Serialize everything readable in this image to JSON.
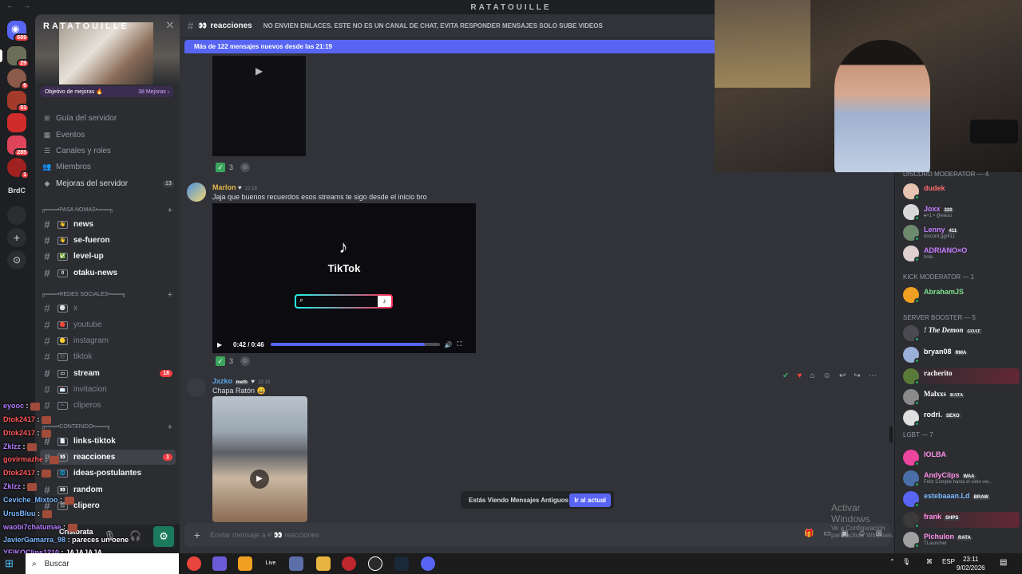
{
  "window": {
    "title": "RATATOUILLE",
    "nav": "← →"
  },
  "rail": {
    "home_badge": "669",
    "servers": [
      {
        "badge": "29"
      },
      {
        "badge": "6"
      },
      {
        "badge": "53"
      },
      {
        "badge": ""
      },
      {
        "badge": "285"
      },
      {
        "badge": "1"
      }
    ],
    "brdc_label": "BrdC",
    "add_label": "+",
    "explore_label": "⊙"
  },
  "server": {
    "name": "RATATOUILLE",
    "boost_goal": "Objetivo de mejoras 🔥",
    "boost_count": "38 Mejoras ›",
    "menu": [
      {
        "icon": "⊞",
        "label": "Guía del servidor"
      },
      {
        "icon": "▦",
        "label": "Eventos"
      },
      {
        "icon": "☰",
        "label": "Canales y roles"
      },
      {
        "icon": "👥",
        "label": "Miembros"
      },
      {
        "icon": "◆",
        "label": "Mejoras del servidor",
        "count": "13"
      }
    ],
    "categories": [
      {
        "label": "╔═══•PASA NOMAS•═══╗"
      },
      {
        "label": "╔═══•REDES SOCIALES•═══╗"
      },
      {
        "label": "╔═══•CONTENIDO•═══╗"
      }
    ],
    "channels_pasa": [
      {
        "emo": "👋",
        "label": "news",
        "unread": true
      },
      {
        "emo": "👋",
        "label": "se-fueron",
        "unread": true
      },
      {
        "emo": "✅",
        "label": "level-up",
        "unread": true
      },
      {
        "emo": "0",
        "label": "otaku-news",
        "unread": true
      }
    ],
    "channels_redes": [
      {
        "emo": "⚪",
        "label": "x",
        "unread": false
      },
      {
        "emo": "🔴",
        "label": "youtube",
        "unread": false
      },
      {
        "emo": "🟡",
        "label": "instagram",
        "unread": false
      },
      {
        "emo": "⚫",
        "label": "tiktok",
        "unread": false
      },
      {
        "emo": "▭",
        "label": "stream",
        "unread": true,
        "badge": "18"
      },
      {
        "emo": "📩",
        "label": "invitacion",
        "unread": false
      },
      {
        "emo": "✂",
        "label": "cliperos",
        "unread": false
      }
    ],
    "channels_contenido": [
      {
        "emo": "📄",
        "label": "links-tiktok",
        "unread": true
      },
      {
        "emo": "👀",
        "label": "reacciones",
        "unread": true,
        "active": true,
        "badge": "1"
      },
      {
        "emo": "🌐",
        "label": "ideas-postulantes",
        "unread": true
      },
      {
        "emo": "👀",
        "label": "random",
        "unread": true
      },
      {
        "emo": "🎬",
        "label": "clipero",
        "unread": true
      }
    ]
  },
  "stream_chat": [
    {
      "user": "eyooc",
      "color": "#b57bff",
      "msg": ":"
    },
    {
      "user": "Dtok2417",
      "color": "#ff5a5a",
      "msg": ":"
    },
    {
      "user": "Dtok2417",
      "color": "#ff5a5a",
      "msg": ":"
    },
    {
      "user": "Zklzz",
      "color": "#b57bff",
      "msg": ":"
    },
    {
      "user": "govirmazhe",
      "color": "#ff5a5a",
      "msg": ":"
    },
    {
      "user": "Dtok2417",
      "color": "#ff5a5a",
      "msg": ":"
    },
    {
      "user": "Zklzz",
      "color": "#b57bff",
      "msg": ":"
    },
    {
      "user": "Ceviche_Mixtoo",
      "color": "#7ab8ff",
      "msg": ":"
    },
    {
      "user": "UrusBluu",
      "color": "#7ab8ff",
      "msg": ":"
    },
    {
      "user": "waobi7chatumae",
      "color": "#b57bff",
      "msg": ":"
    },
    {
      "user": "JavierGamarra_98",
      "color": "#7ab8ff",
      "msg": ": pareces un oene"
    },
    {
      "user": "YEIKOClips1210",
      "color": "#b57bff",
      "msg": ": JAJAJAJA"
    }
  ],
  "user_panel": {
    "name": "Cristorata",
    "mic": "🎙",
    "headset": "🎧",
    "settings": "⚙"
  },
  "channel": {
    "name": "reacciones",
    "emo": "👀",
    "topic": "NO ENVIEN ENLACES. ESTE NO ES UN CANAL DE CHAT, EVITA RESPONDER MENSAJES SOLO SUBE VIDEOS",
    "new_messages": "Más de 122 mensajes nuevos desde las 21:19"
  },
  "messages": [
    {
      "reaction_count": "3"
    },
    {
      "author": "Marlon",
      "author_color": "#e0b64a",
      "time": "22:16",
      "text": "Jaja que buenos recuerdos esos streams te sigo desde el inicio bro",
      "embed_brand": "TikTok",
      "video_time": "0:42 / 0:46",
      "video_progress": 0.913,
      "reaction_count": "3"
    },
    {
      "author": "Jxzko",
      "author_color": "#5aa6e8",
      "role_tag": "meth",
      "time": "22:16",
      "text": "Chapa Ratón 😄"
    }
  ],
  "old_messages_bar": {
    "text": "Estás Viendo Mensajes Antiguos",
    "button": "Ir al actual"
  },
  "composer": {
    "placeholder": "Enviar mensaje a # 👀 reacciones"
  },
  "windows_watermark": {
    "line1": "Activar Windows",
    "line2": "Ve a Configuración para activar Windows."
  },
  "members": {
    "categories": [
      {
        "label": "DISCORD MODERATOR — 4"
      },
      {
        "label": "KICK MODERATOR — 1"
      },
      {
        "label": "SERVER BOOSTER — 5"
      },
      {
        "label": "LGBT — 7"
      }
    ],
    "discord_mods": [
      {
        "name": "dudek",
        "color": "#ff6b6b",
        "sub": "",
        "tag": ""
      },
      {
        "name": "Joxx",
        "color": "#c77dff",
        "sub": "♠+1 • @eeuu",
        "tag": "320"
      },
      {
        "name": "Lenny",
        "color": "#c77dff",
        "sub": "discord.gg/411",
        "tag": "411"
      },
      {
        "name": "ADRIANO×O",
        "color": "#c77dff",
        "sub": "hola",
        "tag": ""
      }
    ],
    "kick_mods": [
      {
        "name": "AbrahamJS",
        "color": "#7ee08a",
        "sub": "",
        "tag": ""
      }
    ],
    "boosters": [
      {
        "name": "! The Demon",
        "color": "#ffffff",
        "sub": "",
        "tag": "GOAT"
      },
      {
        "name": "bryan08",
        "color": "#ffffff",
        "sub": "",
        "tag": "RMA"
      },
      {
        "name": "racherito",
        "color": "#ffffff",
        "sub": "",
        "tag": ""
      },
      {
        "name": "Malxxs",
        "color": "#ffffff",
        "sub": "",
        "tag": "RATA"
      },
      {
        "name": "rodri.",
        "color": "#ffffff",
        "sub": "",
        "tag": "SEXO"
      }
    ],
    "lgbt": [
      {
        "name": "IOLBA",
        "color": "#ff8fe6",
        "sub": "",
        "tag": ""
      },
      {
        "name": "AndyClips",
        "color": "#ff8fe6",
        "sub": "Feliz Cumple hasta el cielo vie...",
        "tag": "WAA"
      },
      {
        "name": "estebaaan.Ld",
        "color": "#7ab8ff",
        "sub": "",
        "tag": "BRAW"
      },
      {
        "name": "frank",
        "color": "#ff8fe6",
        "sub": "",
        "tag": "SHPS"
      },
      {
        "name": "Pichulon",
        "color": "#ff8fe6",
        "sub": "TLauncher",
        "tag": "RATA"
      }
    ]
  },
  "taskbar": {
    "search": "Buscar",
    "lang": "ESP",
    "time": "23:11",
    "date": "9/02/2026",
    "live_label": "Live"
  }
}
